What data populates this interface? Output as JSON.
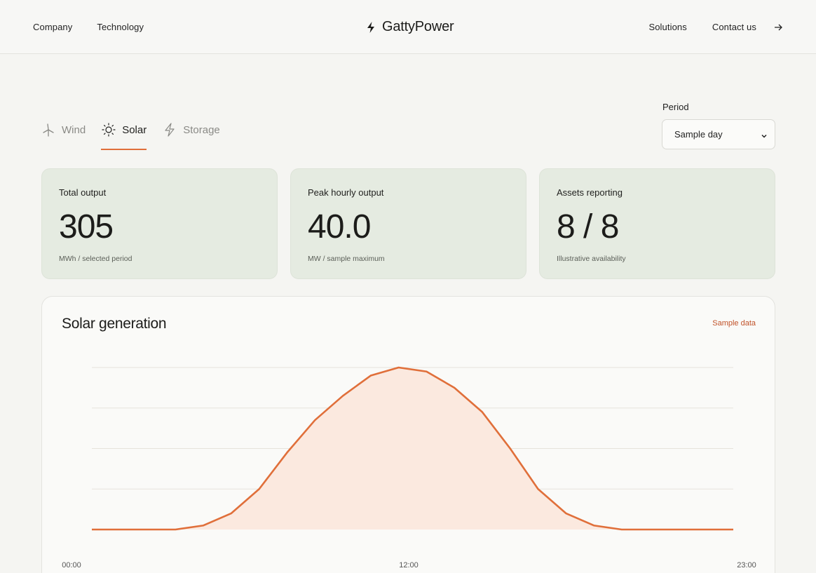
{
  "header": {
    "nav_left": [
      "Company",
      "Technology"
    ],
    "brand": "GattyPower",
    "nav_right": [
      "Solutions",
      "Contact us"
    ],
    "icons": {
      "brand": "bolt-icon",
      "cta": "arrow-right-icon"
    }
  },
  "tabs": [
    {
      "label": "Wind",
      "icon": "wind-turbine-icon",
      "active": false
    },
    {
      "label": "Solar",
      "icon": "sun-icon",
      "active": true
    },
    {
      "label": "Storage",
      "icon": "bolt-icon",
      "active": false
    }
  ],
  "period": {
    "label": "Period",
    "selected": "Sample day"
  },
  "kpis": [
    {
      "label": "Total output",
      "value": "305",
      "unit": "MWh / selected period"
    },
    {
      "label": "Peak hourly output",
      "value": "40.0",
      "unit": "MW / sample maximum"
    },
    {
      "label": "Assets reporting",
      "value": "8 / 8",
      "unit": "Illustrative availability"
    }
  ],
  "chart": {
    "title": "Solar generation",
    "badge": "Sample data"
  },
  "chart_data": {
    "type": "area",
    "title": "Solar generation",
    "x": [
      "00:00",
      "01:00",
      "02:00",
      "03:00",
      "04:00",
      "05:00",
      "06:00",
      "07:00",
      "08:00",
      "09:00",
      "10:00",
      "11:00",
      "12:00",
      "13:00",
      "14:00",
      "15:00",
      "16:00",
      "17:00",
      "18:00",
      "19:00",
      "20:00",
      "21:00",
      "22:00",
      "23:00"
    ],
    "x_tick_labels": [
      "00:00",
      "12:00",
      "23:00"
    ],
    "values": [
      0,
      0,
      0,
      0,
      1,
      4,
      10,
      19,
      27,
      33,
      38,
      40,
      39,
      35,
      29,
      20,
      10,
      4,
      1,
      0,
      0,
      0,
      0,
      0
    ],
    "ylim": [
      0,
      40
    ],
    "grid": true,
    "colors": {
      "line": "#e06f3a",
      "fill": "#fbe9df",
      "grid": "#e6e3dc"
    }
  }
}
